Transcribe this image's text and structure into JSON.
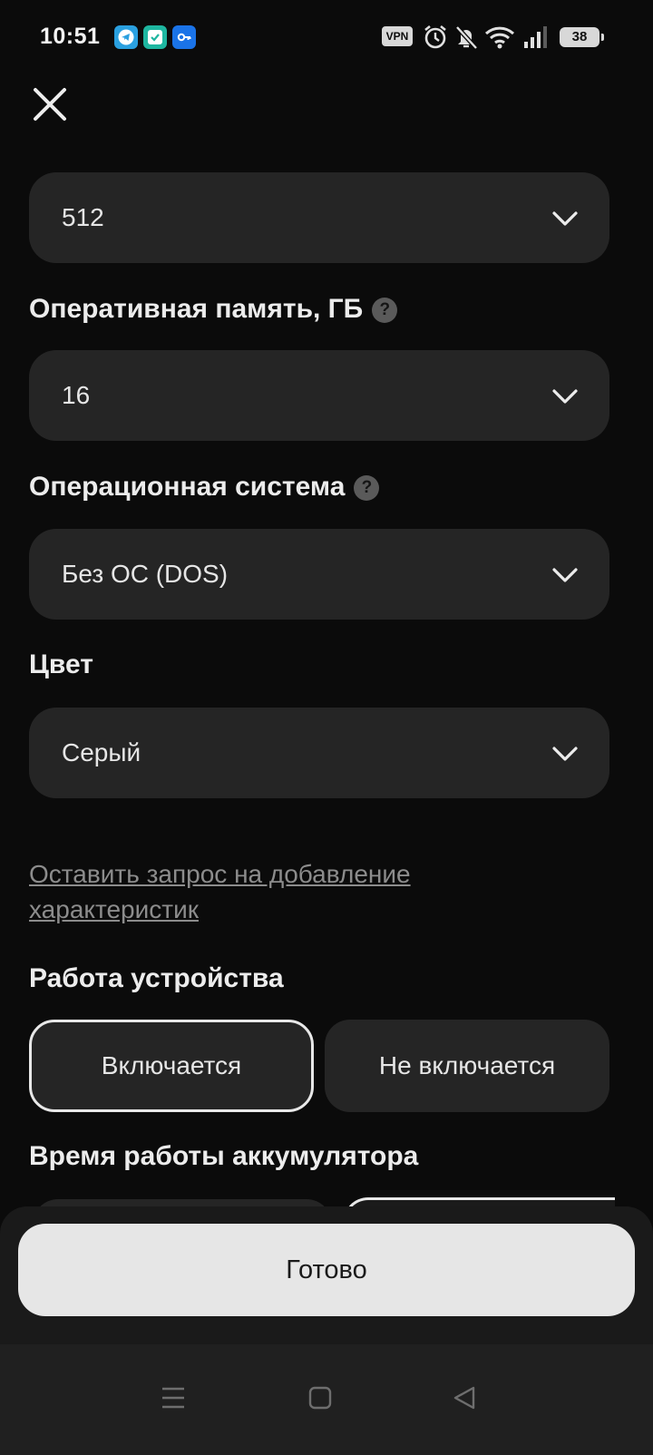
{
  "status_bar": {
    "time": "10:51",
    "vpn": "VPN",
    "battery": "38",
    "notification_icons": [
      "telegram-icon",
      "task-check-icon",
      "key-icon"
    ],
    "system_icons": [
      "alarm-icon",
      "bell-off-icon",
      "wifi-icon",
      "signal-icon"
    ]
  },
  "header": {
    "close_icon": "close-icon"
  },
  "fields": {
    "storage_value": "512",
    "ram_label": "Оперативная память, ГБ",
    "ram_value": "16",
    "os_label": "Операционная система",
    "os_value": "Без ОС (DOS)",
    "color_label": "Цвет",
    "color_value": "Серый",
    "help_glyph": "?"
  },
  "request_link": "Оставить запрос на добавление характеристик",
  "device_work": {
    "label": "Работа устройства",
    "options": [
      "Включается",
      "Не включается"
    ],
    "selected": "Включается"
  },
  "battery_life": {
    "label": "Время работы аккумулятора"
  },
  "done_button": "Готово",
  "nav_bar": [
    "menu-icon",
    "home-square-icon",
    "back-triangle-icon"
  ],
  "colors": {
    "background": "#0b0b0b",
    "field": "#252525",
    "button": "#e6e6e6",
    "link": "#8c8c8c"
  }
}
